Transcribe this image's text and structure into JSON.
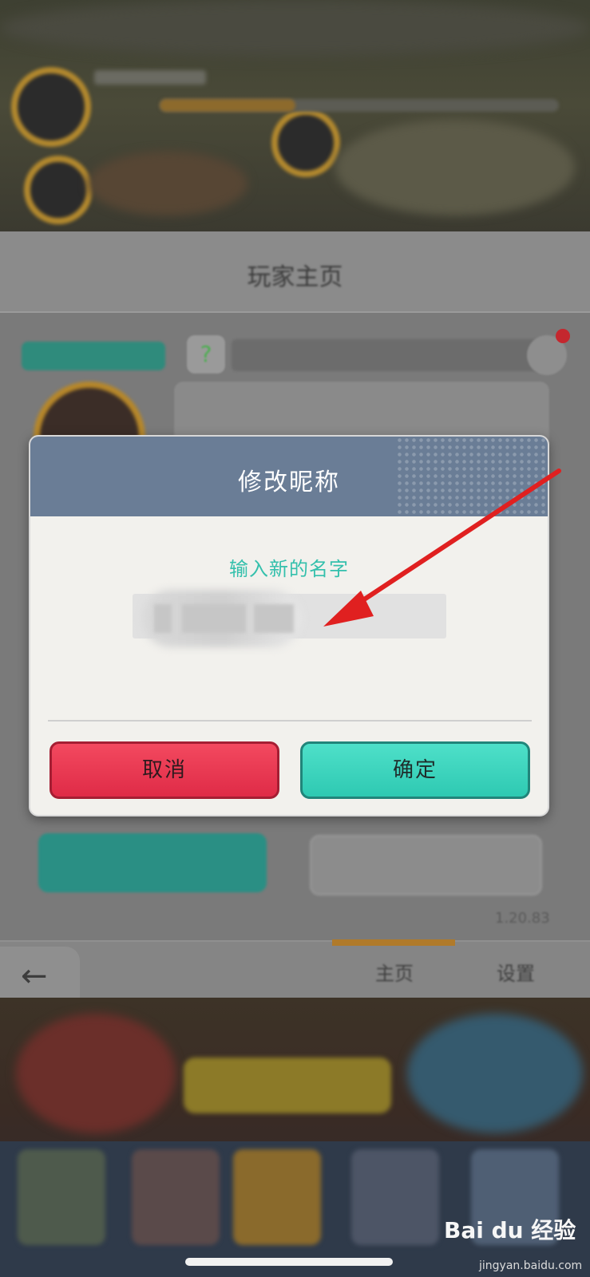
{
  "background": {
    "panel_title": "玩家主页",
    "help_glyph": "?",
    "tab_home": "主页",
    "tab_settings": "设置",
    "back_label": "返回",
    "version": "1.20.83"
  },
  "dialog": {
    "title": "修改昵称",
    "prompt": "输入新的名字",
    "input_value": "",
    "cancel_label": "取消",
    "confirm_label": "确定"
  },
  "watermark": {
    "brand": "Bai du 经验",
    "url": "jingyan.baidu.com"
  },
  "colors": {
    "dialog_header": "#6a7d96",
    "prompt_text": "#34c0ac",
    "cancel_button": "#e33550",
    "confirm_button": "#3dd4bd",
    "annotation_arrow": "#e02020"
  },
  "icons": {
    "back": "arrow-left-icon",
    "edit": "pencil-icon",
    "help": "question-icon"
  }
}
